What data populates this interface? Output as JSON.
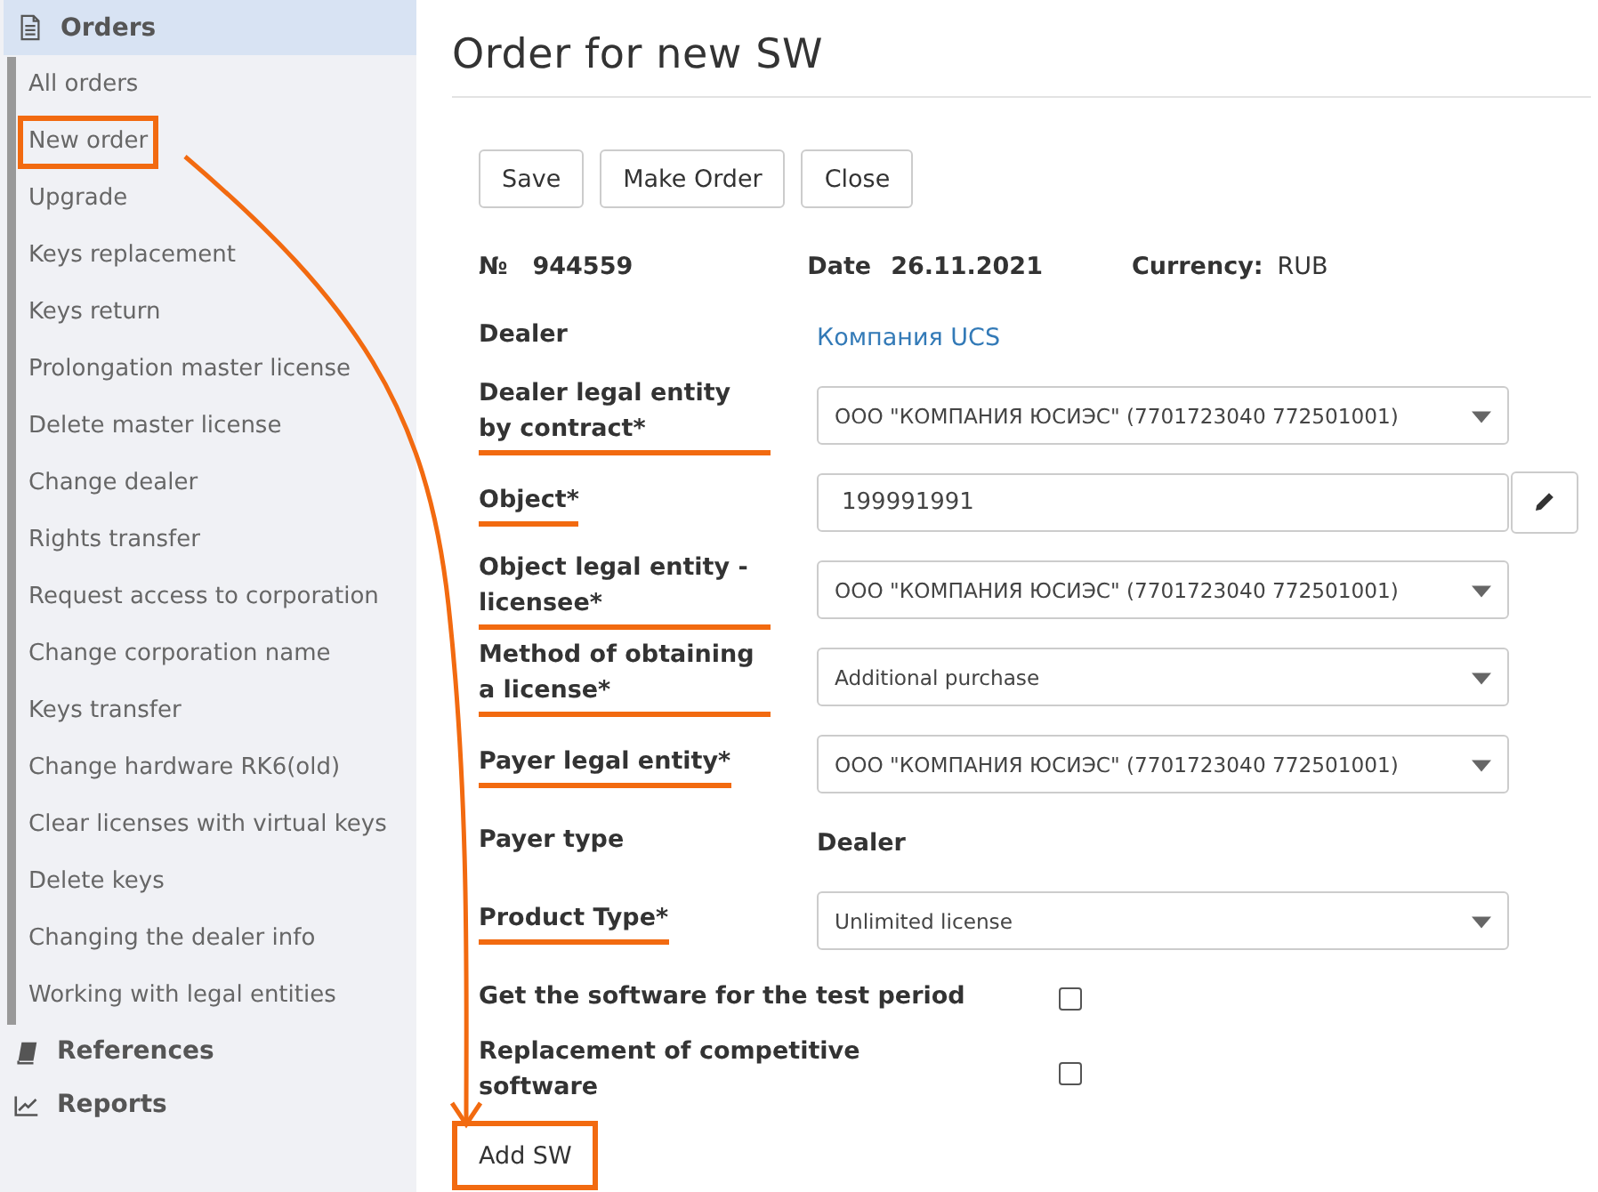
{
  "sidebar": {
    "sections": [
      {
        "label": "Orders",
        "expanded": true,
        "items": [
          {
            "label": "All orders",
            "highlighted": false
          },
          {
            "label": "New order",
            "highlighted": true
          },
          {
            "label": "Upgrade",
            "highlighted": false
          },
          {
            "label": "Keys replacement",
            "highlighted": false
          },
          {
            "label": "Keys return",
            "highlighted": false
          },
          {
            "label": "Prolongation master license",
            "highlighted": false
          },
          {
            "label": "Delete master license",
            "highlighted": false
          },
          {
            "label": "Change dealer",
            "highlighted": false
          },
          {
            "label": "Rights transfer",
            "highlighted": false
          },
          {
            "label": "Request access to corporation",
            "highlighted": false
          },
          {
            "label": "Change corporation name",
            "highlighted": false
          },
          {
            "label": "Keys transfer",
            "highlighted": false
          },
          {
            "label": "Change hardware RK6(old)",
            "highlighted": false
          },
          {
            "label": "Clear licenses with virtual keys",
            "highlighted": false
          },
          {
            "label": "Delete keys",
            "highlighted": false
          },
          {
            "label": "Changing the dealer info",
            "highlighted": false
          },
          {
            "label": "Working with legal entities",
            "highlighted": false
          }
        ]
      },
      {
        "label": "References",
        "expanded": false
      },
      {
        "label": "Reports",
        "expanded": false
      }
    ]
  },
  "page": {
    "title": "Order for new SW",
    "buttons": [
      "Save",
      "Make Order",
      "Close"
    ],
    "info": {
      "number_label": "№",
      "number": "944559",
      "date_label": "Date",
      "date": "26.11.2021",
      "currency_label": "Currency:",
      "currency": "RUB"
    },
    "fields": [
      {
        "kind": "link",
        "label": "Dealer",
        "value": "Компания UCS",
        "underlined": false
      },
      {
        "kind": "select",
        "label": "Dealer legal entity by contract*",
        "value": "ООО \"КОМПАНИЯ ЮСИЭС\" (7701723040 772501001)",
        "underlined": true
      },
      {
        "kind": "input",
        "label": "Object*",
        "value": "199991991",
        "underlined": true
      },
      {
        "kind": "select",
        "label": "Object legal entity - licensee*",
        "value": "ООО \"КОМПАНИЯ ЮСИЭС\" (7701723040 772501001)",
        "underlined": true
      },
      {
        "kind": "select",
        "label": "Method of obtaining a license*",
        "value": "Additional purchase",
        "underlined": true
      },
      {
        "kind": "select",
        "label": "Payer legal entity*",
        "value": "ООО \"КОМПАНИЯ ЮСИЭС\" (7701723040 772501001)",
        "underlined": true
      },
      {
        "kind": "text",
        "label": "Payer type",
        "value": "Dealer",
        "underlined": false
      },
      {
        "kind": "select",
        "label": "Product Type*",
        "value": "Unlimited license",
        "underlined": true
      },
      {
        "kind": "checkbox",
        "label": "Get the software for the test period",
        "checked": false,
        "underlined": false
      },
      {
        "kind": "checkbox",
        "label": "Replacement of competitive software",
        "checked": false,
        "underlined": false
      }
    ],
    "add_button": {
      "label": "Add SW",
      "highlighted": true
    }
  }
}
